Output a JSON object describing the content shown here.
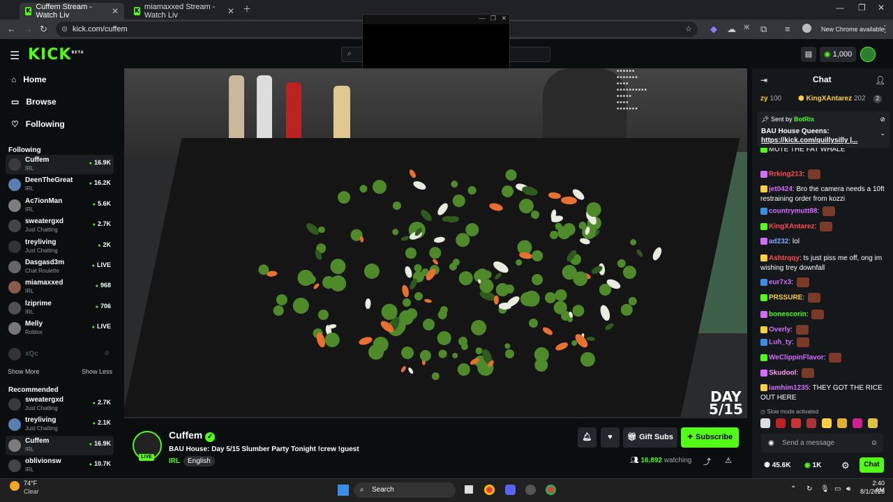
{
  "browser": {
    "tabs": [
      {
        "title": "Cuffem Stream - Watch Liv",
        "active": true
      },
      {
        "title": "miamaxxed Stream - Watch Liv",
        "active": false
      }
    ],
    "url": "kick.com/cuffem",
    "new_chrome": "New Chrome available"
  },
  "header": {
    "logo": "KICK",
    "logo_tag": "BETA",
    "coins": "1,000"
  },
  "sidebar": {
    "nav": [
      {
        "label": "Home",
        "icon": "home-icon"
      },
      {
        "label": "Browse",
        "icon": "browse-icon"
      },
      {
        "label": "Following",
        "icon": "heart-icon"
      }
    ],
    "following_title": "Following",
    "following": [
      {
        "name": "Cuffem",
        "category": "IRL",
        "viewers": "16.9K"
      },
      {
        "name": "DeenTheGreat",
        "category": "IRL",
        "viewers": "16.2K"
      },
      {
        "name": "Ac7ionMan",
        "category": "IRL",
        "viewers": "5.6K"
      },
      {
        "name": "sweatergxd",
        "category": "Just Chatting",
        "viewers": "2.7K"
      },
      {
        "name": "treyliving",
        "category": "Just Chatting",
        "viewers": "2K"
      },
      {
        "name": "Dasgasd3m",
        "category": "Chat Roulette",
        "viewers": "LIVE"
      },
      {
        "name": "miamaxxed",
        "category": "IRL",
        "viewers": "968"
      },
      {
        "name": "lziprime",
        "category": "IRL",
        "viewers": "706"
      },
      {
        "name": "Melly",
        "category": "Roblox",
        "viewers": "LIVE"
      }
    ],
    "offline": "xQc",
    "show_more": "Show More",
    "show_less": "Show Less",
    "recommended_title": "Recommended",
    "recommended": [
      {
        "name": "sweatergxd",
        "category": "Just Chatting",
        "viewers": "2.7K"
      },
      {
        "name": "treyliving",
        "category": "Just Chatting",
        "viewers": "2.1K"
      },
      {
        "name": "Cuffem",
        "category": "IRL",
        "viewers": "16.9K"
      },
      {
        "name": "oblivionsw",
        "category": "IRL",
        "viewers": "10.7K"
      }
    ]
  },
  "video": {
    "day_label": "DAY",
    "day_count": "5/15"
  },
  "stream": {
    "name": "Cuffem",
    "live": "LIVE",
    "title": "BAU House: Day 5/15 Slumber Party Tonight !crew !guest",
    "category": "IRL",
    "language": "English",
    "gift_subs": "Gift Subs",
    "subscribe": "Subscribe",
    "viewers": "16,892",
    "watching": "watching"
  },
  "chat": {
    "title": "Chat",
    "top_gifters": [
      {
        "name": "zy",
        "count": "100"
      },
      {
        "name": "KingXAntarez",
        "count": "202"
      }
    ],
    "pinned": {
      "sent_by": "Sent by",
      "bot": "BotRix",
      "text": "BAU House Queens:",
      "link": "https://kick.com/quillysilly |..."
    },
    "messages": [
      {
        "user": "",
        "text": "MUTE THE FAT WHALE",
        "color": "#ffffff"
      },
      {
        "user": "Rrking213",
        "text": "",
        "color": "#ff4d4d"
      },
      {
        "user": "jet0424",
        "text": "Bro the camera needs a 10ft restraining order from kozzi",
        "color": "#d36dff"
      },
      {
        "user": "countrymutt88",
        "text": "",
        "color": "#d36dff"
      },
      {
        "user": "KingXAntarez",
        "text": "",
        "color": "#ff4d4d"
      },
      {
        "user": "ad232",
        "text": "lol",
        "color": "#7aa7ff"
      },
      {
        "user": "Ashtrqqy",
        "text": "ts just piss me off, ong im wishing trey downfall",
        "color": "#ff4d4d"
      },
      {
        "user": "eur7x3",
        "text": "",
        "color": "#d36dff"
      },
      {
        "user": "PRSSURE",
        "text": "",
        "color": "#ffcf40"
      },
      {
        "user": "bonescorin",
        "text": "",
        "color": "#53fc18"
      },
      {
        "user": "Overly",
        "text": "",
        "color": "#d36dff"
      },
      {
        "user": "Luh_ty",
        "text": "",
        "color": "#d36dff"
      },
      {
        "user": "WeClippinFlavor",
        "text": "",
        "color": "#d36dff"
      },
      {
        "user": "Skudool",
        "text": "",
        "color": "#ff9ef5"
      },
      {
        "user": "iamhim1235",
        "text": "THEY GOT THE RICE OUT HERE",
        "color": "#d36dff"
      }
    ],
    "slow_mode": "Slow mode activated",
    "placeholder": "Send a message",
    "points": "45.6K",
    "kick_points": "1K",
    "chat_button": "Chat"
  },
  "taskbar": {
    "weather_temp": "74°F",
    "weather_desc": "Clear",
    "search": "Search",
    "time": "2:40 AM",
    "date": "8/1/2026"
  }
}
